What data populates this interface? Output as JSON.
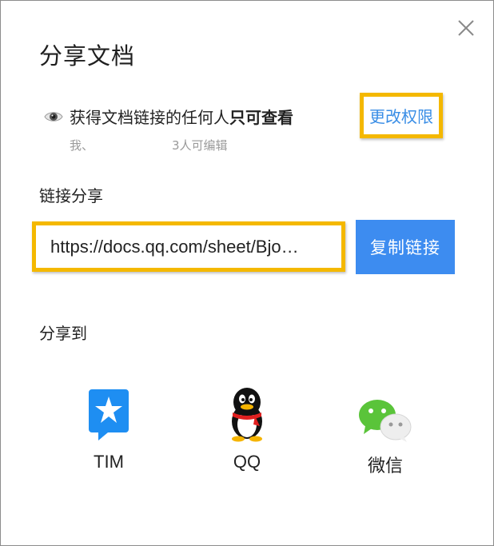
{
  "dialog": {
    "title": "分享文档",
    "close_icon": "close-icon"
  },
  "permission": {
    "icon": "eye-icon",
    "text_prefix": "获得文档链接的任何人",
    "text_strong": "只可查看",
    "sub_owner": "我、",
    "sub_editors": "3人可编辑",
    "change_label": "更改权限",
    "change_color": "#3a8ee6"
  },
  "link_share": {
    "label": "链接分享",
    "url": "https://docs.qq.com/sheet/Bjo…",
    "copy_label": "复制链接",
    "copy_color": "#3d8cf0"
  },
  "share_to": {
    "label": "分享到",
    "targets": [
      {
        "label": "TIM",
        "icon": "tim-icon"
      },
      {
        "label": "QQ",
        "icon": "qq-icon"
      },
      {
        "label": "微信",
        "icon": "wechat-icon"
      }
    ]
  },
  "highlight_color": "#f4b800"
}
